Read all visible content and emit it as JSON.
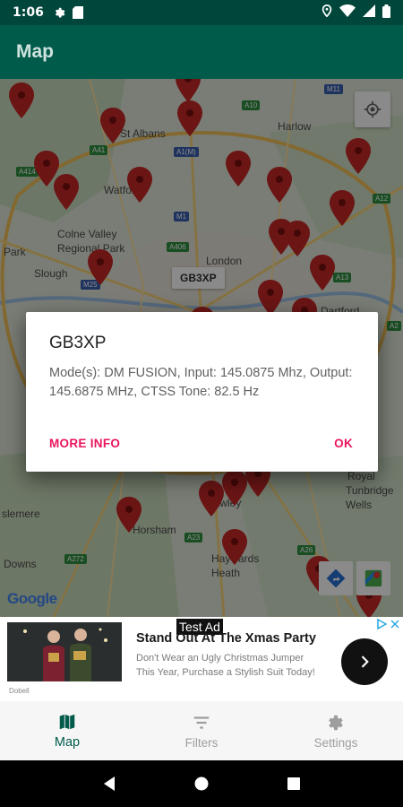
{
  "status_bar": {
    "time": "1:06"
  },
  "app_bar": {
    "title": "Map"
  },
  "map": {
    "callout": "GB3XP",
    "attribution": "Google",
    "place_labels": [
      {
        "text": "St Albans"
      },
      {
        "text": "Harlow"
      },
      {
        "text": "Watford"
      },
      {
        "text": "Colne Valley"
      },
      {
        "text": "Regional Park"
      },
      {
        "text": "London"
      },
      {
        "text": "Slough"
      },
      {
        "text": "Dartford"
      },
      {
        "text": "Crawley"
      },
      {
        "text": "Horsham"
      },
      {
        "text": "Haywards"
      },
      {
        "text": "Heath"
      },
      {
        "text": "Downs"
      },
      {
        "text": "Royal"
      },
      {
        "text": "Tunbridge"
      },
      {
        "text": "Wells"
      },
      {
        "text": "slemere"
      },
      {
        "text": "Park"
      }
    ],
    "road_labels": [
      "M11",
      "A10",
      "A1(M)",
      "A41",
      "A414",
      "M1",
      "A406",
      "M25",
      "A13",
      "A12",
      "A2",
      "A23",
      "A272",
      "A26"
    ]
  },
  "dialog": {
    "title": "GB3XP",
    "body": "Mode(s): DM FUSION, Input: 145.0875 Mhz, Output: 145.6875 MHz, CTSS Tone: 82.5 Hz",
    "more_info": "MORE INFO",
    "ok": "OK"
  },
  "ad": {
    "test_label": "Test Ad",
    "headline": "Stand Out At The Xmas Party",
    "body": "Don't Wear an Ugly Christmas Jumper This Year, Purchase a Stylish Suit Today!",
    "thumb_caption": "Dobell"
  },
  "bottom_nav": {
    "items": [
      {
        "label": "Map",
        "icon": "map-icon",
        "active": true
      },
      {
        "label": "Filters",
        "icon": "filter-icon",
        "active": false
      },
      {
        "label": "Settings",
        "icon": "gear-icon",
        "active": false
      }
    ]
  },
  "colors": {
    "primary": "#005b4b",
    "status_bar": "#00463a",
    "accent": "#e9155b",
    "pin": "#c62828"
  }
}
